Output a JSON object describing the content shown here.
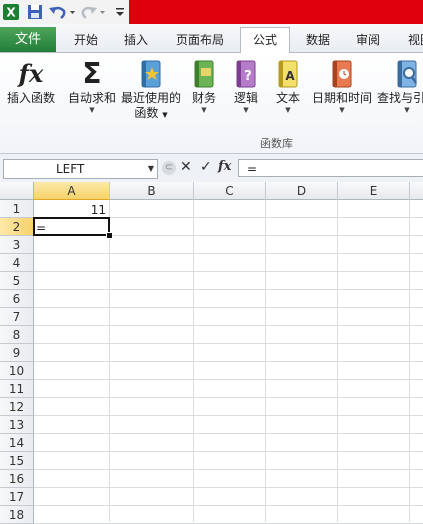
{
  "tabs": {
    "file": "文件",
    "home": "开始",
    "insert": "插入",
    "page_layout": "页面布局",
    "formulas": "公式",
    "data": "数据",
    "review": "审阅",
    "view": "视图"
  },
  "ribbon": {
    "insert_function": "插入函数",
    "autosum": "自动求和",
    "recently_used": "最近使用的",
    "recently_used_2": "函数",
    "financial": "财务",
    "logical": "逻辑",
    "text": "文本",
    "date_time": "日期和时间",
    "lookup": "查找与引用",
    "group_label": "函数库",
    "autosum_symbol": "Σ",
    "fx_symbol": "fx"
  },
  "formula_bar": {
    "name_box": "LEFT",
    "cancel": "✕",
    "enter": "✓",
    "fx": "fx",
    "content": "="
  },
  "grid": {
    "columns": [
      "A",
      "B",
      "C",
      "D",
      "E"
    ],
    "rows": [
      "1",
      "2",
      "3",
      "4",
      "5",
      "6",
      "7",
      "8",
      "9",
      "10",
      "11",
      "12",
      "13",
      "14",
      "15",
      "16",
      "17",
      "18"
    ],
    "A1": "11",
    "A2": "="
  },
  "colors": {
    "file_tab": "#217e38",
    "title_bar_accent": "#e0000d",
    "active_header": "#f7d26b"
  }
}
